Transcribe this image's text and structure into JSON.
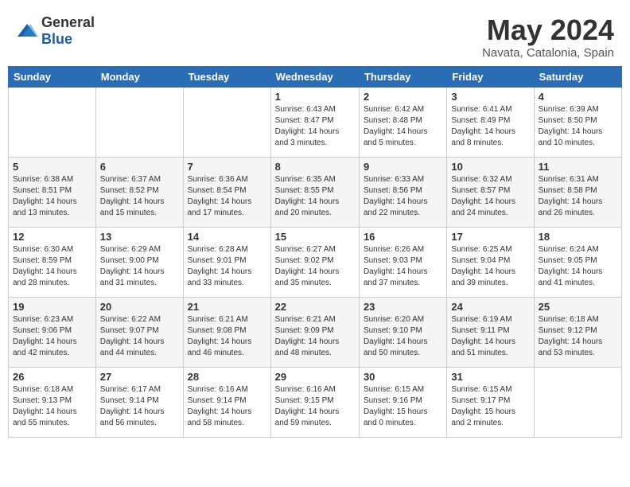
{
  "header": {
    "logo": {
      "general": "General",
      "blue": "Blue"
    },
    "month": "May 2024",
    "location": "Navata, Catalonia, Spain"
  },
  "weekdays": [
    "Sunday",
    "Monday",
    "Tuesday",
    "Wednesday",
    "Thursday",
    "Friday",
    "Saturday"
  ],
  "weeks": [
    [
      {
        "day": "",
        "info": ""
      },
      {
        "day": "",
        "info": ""
      },
      {
        "day": "",
        "info": ""
      },
      {
        "day": "1",
        "info": "Sunrise: 6:43 AM\nSunset: 8:47 PM\nDaylight: 14 hours\nand 3 minutes."
      },
      {
        "day": "2",
        "info": "Sunrise: 6:42 AM\nSunset: 8:48 PM\nDaylight: 14 hours\nand 5 minutes."
      },
      {
        "day": "3",
        "info": "Sunrise: 6:41 AM\nSunset: 8:49 PM\nDaylight: 14 hours\nand 8 minutes."
      },
      {
        "day": "4",
        "info": "Sunrise: 6:39 AM\nSunset: 8:50 PM\nDaylight: 14 hours\nand 10 minutes."
      }
    ],
    [
      {
        "day": "5",
        "info": "Sunrise: 6:38 AM\nSunset: 8:51 PM\nDaylight: 14 hours\nand 13 minutes."
      },
      {
        "day": "6",
        "info": "Sunrise: 6:37 AM\nSunset: 8:52 PM\nDaylight: 14 hours\nand 15 minutes."
      },
      {
        "day": "7",
        "info": "Sunrise: 6:36 AM\nSunset: 8:54 PM\nDaylight: 14 hours\nand 17 minutes."
      },
      {
        "day": "8",
        "info": "Sunrise: 6:35 AM\nSunset: 8:55 PM\nDaylight: 14 hours\nand 20 minutes."
      },
      {
        "day": "9",
        "info": "Sunrise: 6:33 AM\nSunset: 8:56 PM\nDaylight: 14 hours\nand 22 minutes."
      },
      {
        "day": "10",
        "info": "Sunrise: 6:32 AM\nSunset: 8:57 PM\nDaylight: 14 hours\nand 24 minutes."
      },
      {
        "day": "11",
        "info": "Sunrise: 6:31 AM\nSunset: 8:58 PM\nDaylight: 14 hours\nand 26 minutes."
      }
    ],
    [
      {
        "day": "12",
        "info": "Sunrise: 6:30 AM\nSunset: 8:59 PM\nDaylight: 14 hours\nand 28 minutes."
      },
      {
        "day": "13",
        "info": "Sunrise: 6:29 AM\nSunset: 9:00 PM\nDaylight: 14 hours\nand 31 minutes."
      },
      {
        "day": "14",
        "info": "Sunrise: 6:28 AM\nSunset: 9:01 PM\nDaylight: 14 hours\nand 33 minutes."
      },
      {
        "day": "15",
        "info": "Sunrise: 6:27 AM\nSunset: 9:02 PM\nDaylight: 14 hours\nand 35 minutes."
      },
      {
        "day": "16",
        "info": "Sunrise: 6:26 AM\nSunset: 9:03 PM\nDaylight: 14 hours\nand 37 minutes."
      },
      {
        "day": "17",
        "info": "Sunrise: 6:25 AM\nSunset: 9:04 PM\nDaylight: 14 hours\nand 39 minutes."
      },
      {
        "day": "18",
        "info": "Sunrise: 6:24 AM\nSunset: 9:05 PM\nDaylight: 14 hours\nand 41 minutes."
      }
    ],
    [
      {
        "day": "19",
        "info": "Sunrise: 6:23 AM\nSunset: 9:06 PM\nDaylight: 14 hours\nand 42 minutes."
      },
      {
        "day": "20",
        "info": "Sunrise: 6:22 AM\nSunset: 9:07 PM\nDaylight: 14 hours\nand 44 minutes."
      },
      {
        "day": "21",
        "info": "Sunrise: 6:21 AM\nSunset: 9:08 PM\nDaylight: 14 hours\nand 46 minutes."
      },
      {
        "day": "22",
        "info": "Sunrise: 6:21 AM\nSunset: 9:09 PM\nDaylight: 14 hours\nand 48 minutes."
      },
      {
        "day": "23",
        "info": "Sunrise: 6:20 AM\nSunset: 9:10 PM\nDaylight: 14 hours\nand 50 minutes."
      },
      {
        "day": "24",
        "info": "Sunrise: 6:19 AM\nSunset: 9:11 PM\nDaylight: 14 hours\nand 51 minutes."
      },
      {
        "day": "25",
        "info": "Sunrise: 6:18 AM\nSunset: 9:12 PM\nDaylight: 14 hours\nand 53 minutes."
      }
    ],
    [
      {
        "day": "26",
        "info": "Sunrise: 6:18 AM\nSunset: 9:13 PM\nDaylight: 14 hours\nand 55 minutes."
      },
      {
        "day": "27",
        "info": "Sunrise: 6:17 AM\nSunset: 9:14 PM\nDaylight: 14 hours\nand 56 minutes."
      },
      {
        "day": "28",
        "info": "Sunrise: 6:16 AM\nSunset: 9:14 PM\nDaylight: 14 hours\nand 58 minutes."
      },
      {
        "day": "29",
        "info": "Sunrise: 6:16 AM\nSunset: 9:15 PM\nDaylight: 14 hours\nand 59 minutes."
      },
      {
        "day": "30",
        "info": "Sunrise: 6:15 AM\nSunset: 9:16 PM\nDaylight: 15 hours\nand 0 minutes."
      },
      {
        "day": "31",
        "info": "Sunrise: 6:15 AM\nSunset: 9:17 PM\nDaylight: 15 hours\nand 2 minutes."
      },
      {
        "day": "",
        "info": ""
      }
    ]
  ]
}
